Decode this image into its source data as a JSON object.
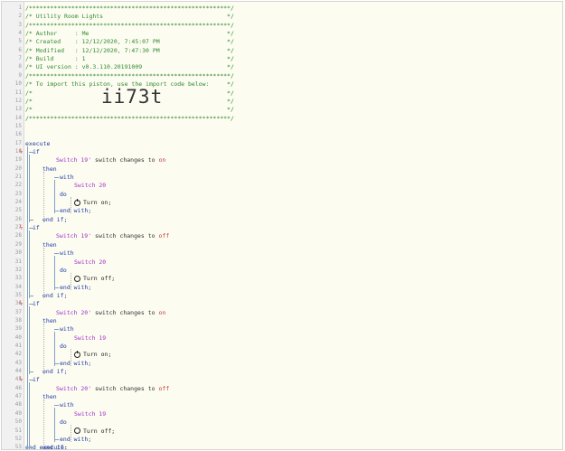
{
  "header_comment": [
    "/*********************************************************/",
    "/* Utility Room Lights                                   */",
    "/*********************************************************/",
    "/* Author     : Me                                       */",
    "/* Created    : 12/12/2020, 7:45:07 PM                   */",
    "/* Modified   : 12/12/2020, 7:47:30 PM                   */",
    "/* Build      : 1                                        */",
    "/* UI version : v0.3.110.20191009                        */",
    "/*********************************************************/",
    "/* To import this piston, use the import code below:     */",
    "/*                                                       */",
    "/*                                                       */",
    "/*                                                       */",
    "/*********************************************************/"
  ],
  "import_code": "ii73t",
  "keywords": {
    "execute": "execute",
    "if": "if",
    "then": "then",
    "with": "with",
    "do": "do",
    "end_with": "end with;",
    "end_if": "end if;",
    "end_execute": "end execute;",
    "switch_changes_to": "switch changes to"
  },
  "blocks": [
    {
      "trigger_device": "Switch 19'",
      "trigger_value": "on",
      "target_device": "Switch 20",
      "action": "Turn on;",
      "action_icon": "power-on-icon"
    },
    {
      "trigger_device": "Switch 19'",
      "trigger_value": "off",
      "target_device": "Switch 20",
      "action": "Turn off;",
      "action_icon": "power-off-icon"
    },
    {
      "trigger_device": "Switch 20'",
      "trigger_value": "on",
      "target_device": "Switch 19",
      "action": "Turn on;",
      "action_icon": "power-on-icon"
    },
    {
      "trigger_device": "Switch 20'",
      "trigger_value": "off",
      "target_device": "Switch 19",
      "action": "Turn off;",
      "action_icon": "power-off-icon"
    }
  ],
  "line_numbers": [
    "1",
    "2",
    "3",
    "4",
    "5",
    "6",
    "7",
    "8",
    "9",
    "10",
    "11",
    "12",
    "13",
    "14",
    "15",
    "16",
    "17",
    "18",
    "19",
    "20",
    "21",
    "22",
    "23",
    "24",
    "25",
    "26",
    "27",
    "28",
    "29",
    "30",
    "31",
    "32",
    "33",
    "34",
    "35",
    "36",
    "37",
    "38",
    "39",
    "40",
    "41",
    "42",
    "43",
    "44",
    "45",
    "46",
    "47",
    "48",
    "49",
    "50",
    "51",
    "52",
    "53"
  ],
  "trigger_lines": [
    "18",
    "27",
    "36",
    "45"
  ],
  "colors": {
    "comment": "#2e8b2e",
    "keyword": "#1f3aa5",
    "device": "#a033c8",
    "value": "#c03a3a",
    "trigger_marker": "#e05050"
  }
}
